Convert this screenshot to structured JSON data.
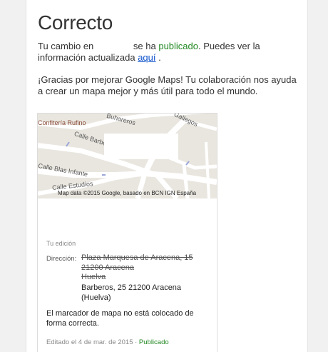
{
  "title": "Correcto",
  "message": {
    "part1": "Tu cambio en",
    "part2": "se ha",
    "status": "publicado",
    "part3": ". Puedes ver la información actualizada",
    "link": "aquí",
    "part4": "."
  },
  "thanks": "¡Gracias por mejorar Google Maps! Tu colaboración nos ayuda a crear un mapa mejor y más útil para todo el mundo.",
  "map": {
    "labels": [
      "Confitería Rufino",
      "Calle Barberos",
      "Calle Blas Infante",
      "Calle Estudios",
      "Buhareros",
      "Gallegos"
    ],
    "attribution": "Map data ©2015 Google, basado en BCN IGN España"
  },
  "edit": {
    "section_label": "Tu edición",
    "direction_label": "Dirección:",
    "old_address": [
      "Plaza Marquesa de Aracena, 15",
      "21200 Aracena",
      "Huelva"
    ],
    "new_address": [
      "Barberos, 25 21200 Aracena",
      "(Huelva)"
    ],
    "note": "El marcador de mapa no está colocado de forma correcta.",
    "footer_date": "Editado el 4 de mar. de 2015 ·",
    "footer_status": "Publicado"
  },
  "colors": {
    "published": "#228822",
    "link": "#1155cc"
  }
}
